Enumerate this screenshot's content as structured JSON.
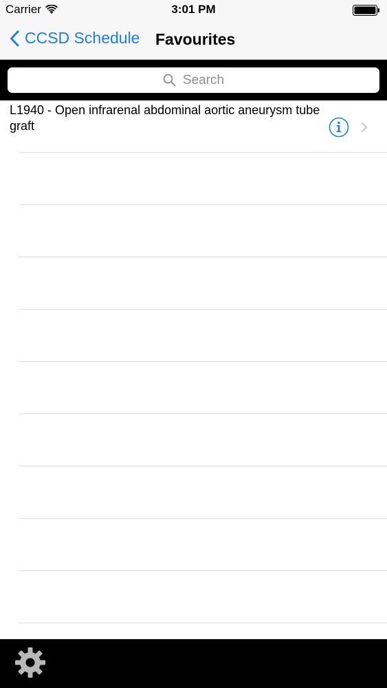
{
  "status_bar": {
    "carrier": "Carrier",
    "time": "3:01 PM"
  },
  "nav": {
    "back_label": "CCSD Schedule",
    "title": "Favourites"
  },
  "search": {
    "placeholder": "Search"
  },
  "list": {
    "items": [
      {
        "label": "L1940 - Open infrarenal abdominal aortic aneurysm tube graft"
      }
    ]
  },
  "colors": {
    "accent": "#1a7ee6",
    "bar_background": "#000000"
  },
  "icons": {
    "back": "chevron-left-icon",
    "search": "search-icon",
    "info": "info-icon",
    "disclosure": "chevron-right-icon",
    "settings": "gear-icon",
    "wifi": "wifi-icon",
    "battery": "battery-icon"
  }
}
